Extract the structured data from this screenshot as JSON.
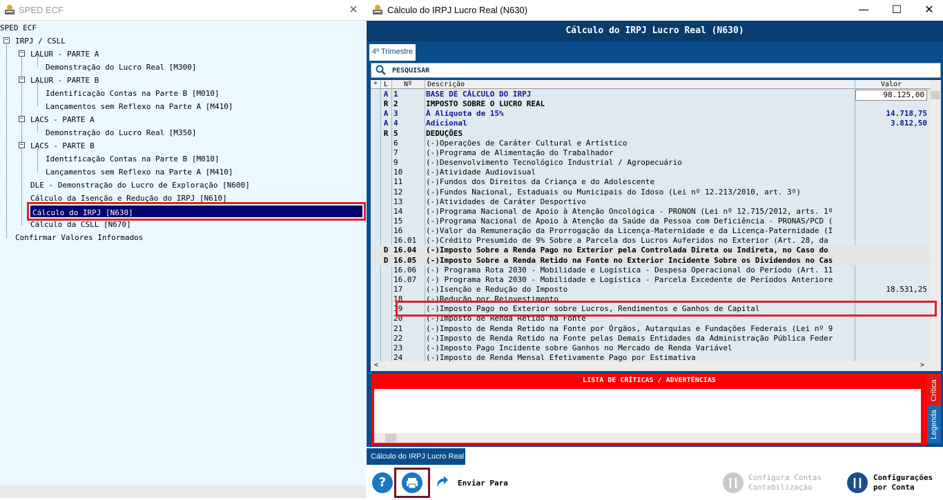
{
  "left": {
    "title": "SPED ECF",
    "tree": [
      {
        "label": "SPED ECF"
      },
      {
        "label": "IRPJ / CSLL"
      },
      {
        "label": "LALUR - PARTE A"
      },
      {
        "label": "Demonstração do Lucro Real [M300]"
      },
      {
        "label": "LALUR - PARTE B"
      },
      {
        "label": "Identificação Contas na Parte B [M010]"
      },
      {
        "label": "Lançamentos sem Reflexo na Parte A [M410]"
      },
      {
        "label": "LACS - PARTE A"
      },
      {
        "label": "Demonstração do Lucro Real [M350]"
      },
      {
        "label": "LACS - PARTE B"
      },
      {
        "label": "Identificação Contas na Parte B [M010]"
      },
      {
        "label": "Lançamentos sem Reflexo na Parte A [M410]"
      },
      {
        "label": "DLE - Demonstração do Lucro de Exploração [N600]"
      },
      {
        "label": "Cálculo da Isenção e Redução do IRPJ [N610]"
      },
      {
        "label": "Cálculo do IRPJ [N630]"
      },
      {
        "label": "Cálculo da CSLL [N670]"
      },
      {
        "label": "Confirmar Valores Informados"
      }
    ]
  },
  "right": {
    "title": "Cálculo do IRPJ Lucro Real (N630)",
    "header": "Cálculo do IRPJ Lucro Real (N630)",
    "tab": "4º Trimestre",
    "search_label": "PESQUISAR",
    "columns": {
      "star": "*",
      "l": "L",
      "n": "Nº",
      "desc": "Descrição",
      "valor": "Valor"
    },
    "rows": [
      {
        "l": "A",
        "n": "1",
        "d": "BASE DE CÁLCULO DO IRPJ",
        "v": "98.125,00",
        "style": "blue"
      },
      {
        "l": "R",
        "n": "2",
        "d": "IMPOSTO SOBRE O LUCRO REAL",
        "v": "",
        "style": "bold"
      },
      {
        "l": "A",
        "n": "3",
        "d": "À Alíquota de 15%",
        "v": "14.718,75",
        "style": "blue"
      },
      {
        "l": "A",
        "n": "4",
        "d": "Adicional",
        "v": "3.812,50",
        "style": "blue"
      },
      {
        "l": "R",
        "n": "5",
        "d": "DEDUÇÕES",
        "v": "",
        "style": "bold"
      },
      {
        "l": "",
        "n": "6",
        "d": "(-)Operações de Caráter Cultural e Artístico",
        "v": "",
        "style": ""
      },
      {
        "l": "",
        "n": "7",
        "d": "(-)Programa de Alimentação do Trabalhador",
        "v": "",
        "style": ""
      },
      {
        "l": "",
        "n": "9",
        "d": "(-)Desenvolvimento Tecnológico Industrial / Agropecuário",
        "v": "",
        "style": ""
      },
      {
        "l": "",
        "n": "10",
        "d": "(-)Atividade Audiovisual",
        "v": "",
        "style": ""
      },
      {
        "l": "",
        "n": "11",
        "d": "(-)Fundos dos Direitos da Criança e do Adolescente",
        "v": "",
        "style": ""
      },
      {
        "l": "",
        "n": "12",
        "d": "(-)Fundos Nacional, Estaduais ou Municipais do Idoso (Lei nº 12.213/2010, art. 3º)",
        "v": "",
        "style": ""
      },
      {
        "l": "",
        "n": "13",
        "d": "(-)Atividades de Caráter Desportivo",
        "v": "",
        "style": ""
      },
      {
        "l": "",
        "n": "14",
        "d": "(-)Programa Nacional de Apoio à Atenção Oncológica - PRONON (Lei nº 12.715/2012, arts. 1º",
        "v": "",
        "style": ""
      },
      {
        "l": "",
        "n": "15",
        "d": "(-)Programa Nacional de Apoio à Atenção da Saúde da Pessoa com Deficiência - PRONAS/PCD (",
        "v": "",
        "style": ""
      },
      {
        "l": "",
        "n": "16",
        "d": "(-)Valor da Remuneração da Prorrogação da Licença-Maternidade e da Licença-Paternidade (I",
        "v": "",
        "style": ""
      },
      {
        "l": "",
        "n": "16.01",
        "d": "(-)Crédito Presumido de 9% Sobre a Parcela dos Lucros Auferidos no Exterior (Art. 28, da",
        "v": "",
        "style": ""
      },
      {
        "l": "D",
        "n": "16.04",
        "d": "(-)Imposto Sobre a Renda Pago no Exterior pela Controlada Direta ou Indireta, no Caso do",
        "v": "",
        "style": "bold gray"
      },
      {
        "l": "D",
        "n": "16.05",
        "d": "(-)Imposto Sobre a Renda Retido na Fonte no Exterior Incidente Sobre os Dividendos no Cas",
        "v": "",
        "style": "bold gray"
      },
      {
        "l": "",
        "n": "16.06",
        "d": "(-) Programa Rota 2030 - Mobilidade e Logística - Despesa Operacional do Período (Art. 11",
        "v": "",
        "style": ""
      },
      {
        "l": "",
        "n": "16.07",
        "d": "(-) Programa Rota 2030 - Mobilidade e Logística - Parcela Excedente de Períodos Anteriore",
        "v": "",
        "style": ""
      },
      {
        "l": "",
        "n": "17",
        "d": "(-)Isenção e Redução do Imposto",
        "v": "18.531,25",
        "style": ""
      },
      {
        "l": "",
        "n": "18",
        "d": "(-)Redução por Reinvestimento",
        "v": "",
        "style": ""
      },
      {
        "l": "",
        "n": "19",
        "d": "(-)Imposto Pago no Exterior sobre Lucros, Rendimentos e Ganhos de Capital",
        "v": "",
        "style": ""
      },
      {
        "l": "",
        "n": "20",
        "d": "(-)Imposto de Renda Retido na Fonte",
        "v": "",
        "style": ""
      },
      {
        "l": "",
        "n": "21",
        "d": "(-)Imposto de Renda Retido na Fonte por Órgãos, Autarquias e Fundações Federais (Lei nº 9",
        "v": "",
        "style": ""
      },
      {
        "l": "",
        "n": "22",
        "d": "(-)Imposto de Renda Retido na Fonte pelas Demais Entidades da Administração Pública Feder",
        "v": "",
        "style": ""
      },
      {
        "l": "",
        "n": "23",
        "d": "(-)Imposto Pago Incidente sobre Ganhos no Mercado de Renda Variável",
        "v": "",
        "style": ""
      },
      {
        "l": "",
        "n": "24",
        "d": "(-)Imposto de Renda Mensal Efetivamente Pago por Estimativa",
        "v": "",
        "style": ""
      }
    ],
    "critics_title": "LISTA DE CRÍTICAS / ADVERTÊNCIAS",
    "side_tab_critica": "Crítica",
    "side_tab_legenda": "Legenda",
    "bottom_tab": "Cálculo do IRPJ Lucro Real",
    "toolbar": {
      "help": "?",
      "enviar": "Enviar Para",
      "configura_1": "Configura Contas",
      "configura_2": "Contabilização",
      "config_conta_1": "Configurações",
      "config_conta_2": "por Conta"
    }
  }
}
